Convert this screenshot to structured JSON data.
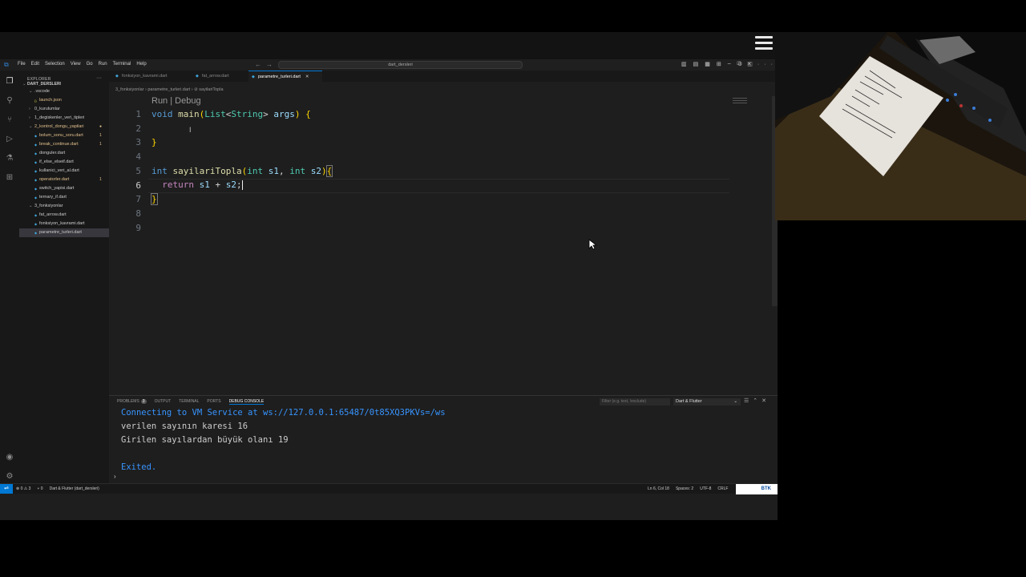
{
  "title_bar": {
    "menu": [
      "File",
      "Edit",
      "Selection",
      "View",
      "Go",
      "Run",
      "Terminal",
      "Help"
    ],
    "search_text": "dart_dersleri"
  },
  "sidebar": {
    "header": "EXPLORER",
    "root": "DART_DERSLERI",
    "tree": [
      {
        "label": ".vscode",
        "indent": 1,
        "folder": true,
        "open": true,
        "color": "#cccccc"
      },
      {
        "label": "launch.json",
        "indent": 2,
        "folder": false,
        "color": "#e2c08d"
      },
      {
        "label": "0_kurulumlar",
        "indent": 1,
        "folder": true,
        "open": false,
        "color": "#cccccc"
      },
      {
        "label": "1_degiskenler_veri_tipleri",
        "indent": 1,
        "folder": true,
        "open": false,
        "color": "#cccccc"
      },
      {
        "label": "2_kontrol_dongu_yapilari",
        "indent": 1,
        "folder": true,
        "open": true,
        "color": "#e2c08d",
        "badge": "●",
        "badge_color": "#e2c08d"
      },
      {
        "label": "bolum_sonu_soru.dart",
        "indent": 2,
        "folder": false,
        "color": "#e2c08d",
        "badge": "1",
        "badge_color": "#e2c08d"
      },
      {
        "label": "break_continue.dart",
        "indent": 2,
        "folder": false,
        "color": "#e2c08d",
        "badge": "1",
        "badge_color": "#e2c08d"
      },
      {
        "label": "donguler.dart",
        "indent": 2,
        "folder": false,
        "color": "#cccccc"
      },
      {
        "label": "if_else_elseif.dart",
        "indent": 2,
        "folder": false,
        "color": "#cccccc"
      },
      {
        "label": "kullanici_veri_al.dart",
        "indent": 2,
        "folder": false,
        "color": "#cccccc"
      },
      {
        "label": "operatorler.dart",
        "indent": 2,
        "folder": false,
        "color": "#e2c08d",
        "badge": "1",
        "badge_color": "#e2c08d"
      },
      {
        "label": "switch_yapisi.dart",
        "indent": 2,
        "folder": false,
        "color": "#cccccc"
      },
      {
        "label": "ternary_if.dart",
        "indent": 2,
        "folder": false,
        "color": "#cccccc"
      },
      {
        "label": "3_fonksiyonlar",
        "indent": 1,
        "folder": true,
        "open": true,
        "color": "#cccccc"
      },
      {
        "label": "fat_arrow.dart",
        "indent": 2,
        "folder": false,
        "color": "#cccccc"
      },
      {
        "label": "fonksiyon_kavrami.dart",
        "indent": 2,
        "folder": false,
        "color": "#cccccc"
      },
      {
        "label": "parametre_turleri.dart",
        "indent": 2,
        "folder": false,
        "color": "#cccccc",
        "selected": true
      }
    ],
    "dependencies": "DEPENDENCIES"
  },
  "tabs": [
    {
      "label": "fonksiyon_kavrami.dart",
      "active": false
    },
    {
      "label": "fat_arrow.dart",
      "active": false
    },
    {
      "label": "parametre_turleri.dart",
      "active": true
    }
  ],
  "breadcrumb": "3_fonksiyonlar  ›  parametre_turleri.dart  ›  ⊘ sayilariTopla",
  "editor": {
    "codelens": "Run | Debug",
    "line_numbers": [
      "1",
      "2",
      "3",
      "4",
      "5",
      "6",
      "7",
      "8",
      "9"
    ],
    "current_line": 6
  },
  "panel": {
    "tabs": [
      "PROBLEMS",
      "OUTPUT",
      "TERMINAL",
      "PORTS",
      "DEBUG CONSOLE"
    ],
    "problems_count": "3",
    "filter_placeholder": "Filter (e.g. text, !exclude)",
    "selected_output": "Dart & Flutter",
    "lines": [
      {
        "text": "Connecting to VM Service at ws://127.0.0.1:65487/0t85XQ3PKVs=/ws",
        "color": "#3794ff"
      },
      {
        "text": "verilen sayının karesi 16",
        "color": "#cccccc"
      },
      {
        "text": "Girilen sayılardan büyük olanı 19",
        "color": "#cccccc"
      },
      {
        "text": "",
        "color": "#cccccc"
      },
      {
        "text": "Exited.",
        "color": "#3794ff"
      }
    ],
    "prompt": "›"
  },
  "status_bar": {
    "problems": "⊗ 0 ⚠ 3",
    "ports": "⑂ 0",
    "language_mode": "Dart & Flutter (dart_dersleri)",
    "cursor_pos": "Ln 6, Col 18",
    "spaces": "Spaces: 2",
    "encoding": "UTF-8",
    "eol": "CRLF",
    "logo": "BTK"
  },
  "colors": {
    "accent": "#0078d4",
    "keyword": "#569cd6",
    "function": "#dcdcaa",
    "type": "#4ec9b0",
    "variable": "#9cdcfe"
  }
}
